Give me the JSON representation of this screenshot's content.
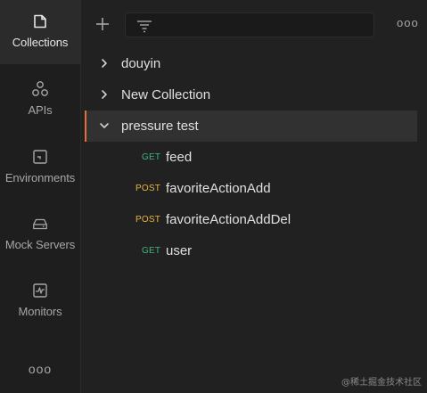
{
  "rail": {
    "items": [
      {
        "label": "Collections",
        "icon": "collections-icon",
        "active": true
      },
      {
        "label": "APIs",
        "icon": "apis-icon",
        "active": false
      },
      {
        "label": "Environments",
        "icon": "environments-icon",
        "active": false
      },
      {
        "label": "Mock Servers",
        "icon": "mock-servers-icon",
        "active": false
      },
      {
        "label": "Monitors",
        "icon": "monitors-icon",
        "active": false
      }
    ],
    "more_label": "ooo"
  },
  "toolbar": {
    "add_icon": "plus-icon",
    "filter_icon": "filter-icon",
    "filter_value": "",
    "more_label": "ooo"
  },
  "tree": {
    "collections": [
      {
        "name": "douyin",
        "expanded": false
      },
      {
        "name": "New Collection",
        "expanded": false
      },
      {
        "name": "pressure test",
        "expanded": true,
        "selected": true
      }
    ],
    "requests": [
      {
        "method": "GET",
        "name": "feed"
      },
      {
        "method": "POST",
        "name": "favoriteActionAdd"
      },
      {
        "method": "POST",
        "name": "favoriteActionAddDel"
      },
      {
        "method": "GET",
        "name": "user"
      }
    ]
  },
  "colors": {
    "get": "#3fb37f",
    "post": "#e8b53f",
    "accent": "#e76e3c"
  },
  "watermark": "@稀土掘金技术社区"
}
